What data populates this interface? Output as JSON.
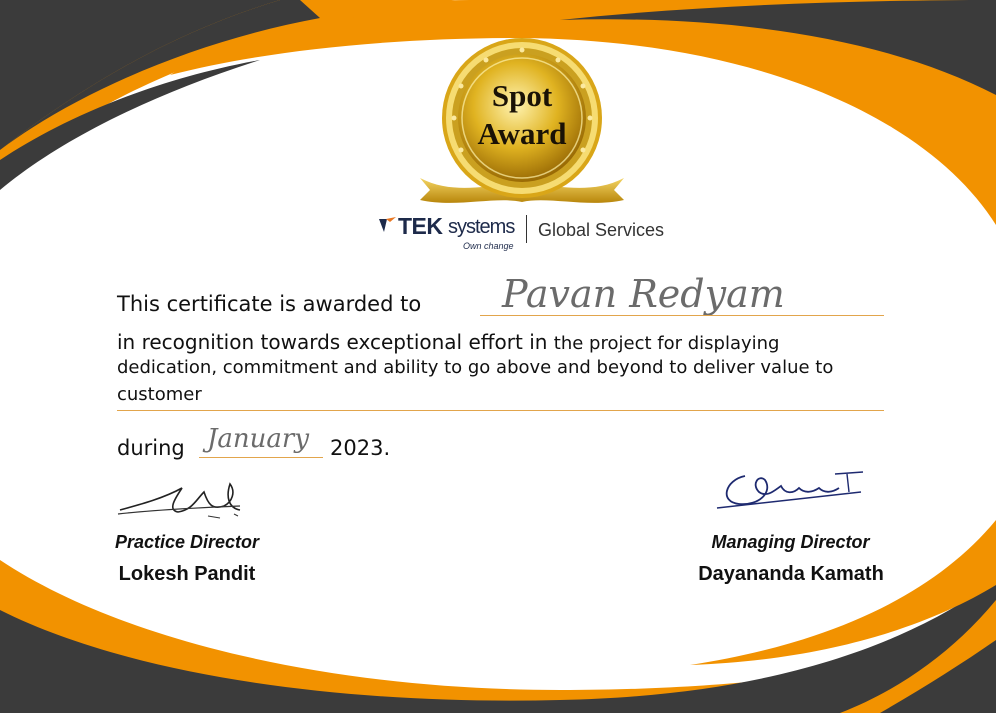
{
  "award": {
    "line1": "Spot",
    "line2": "Award"
  },
  "logo": {
    "brand_bold": "TEK",
    "brand_light": "systems",
    "tagline": "Own change",
    "division": "Global Services"
  },
  "certificate": {
    "awarded_to_label": "This certificate is awarded to",
    "recipient": "Pavan Redyam",
    "recognition_prefix": "in recognition towards exceptional effort in",
    "recognition_line1_rest": "the project for displaying",
    "recognition_line2": "dedication, commitment and ability to go above and beyond to deliver value to",
    "recognition_line3": "customer",
    "during_label": "during",
    "month": "January",
    "year": "2023."
  },
  "signatories": [
    {
      "title": "Practice Director",
      "name": "Lokesh Pandit"
    },
    {
      "title": "Managing Director",
      "name": "Dayananda Kamath"
    }
  ],
  "colors": {
    "orange": "#f29200",
    "dark_gray": "#3b3b3b",
    "gold": "#d4a017"
  }
}
